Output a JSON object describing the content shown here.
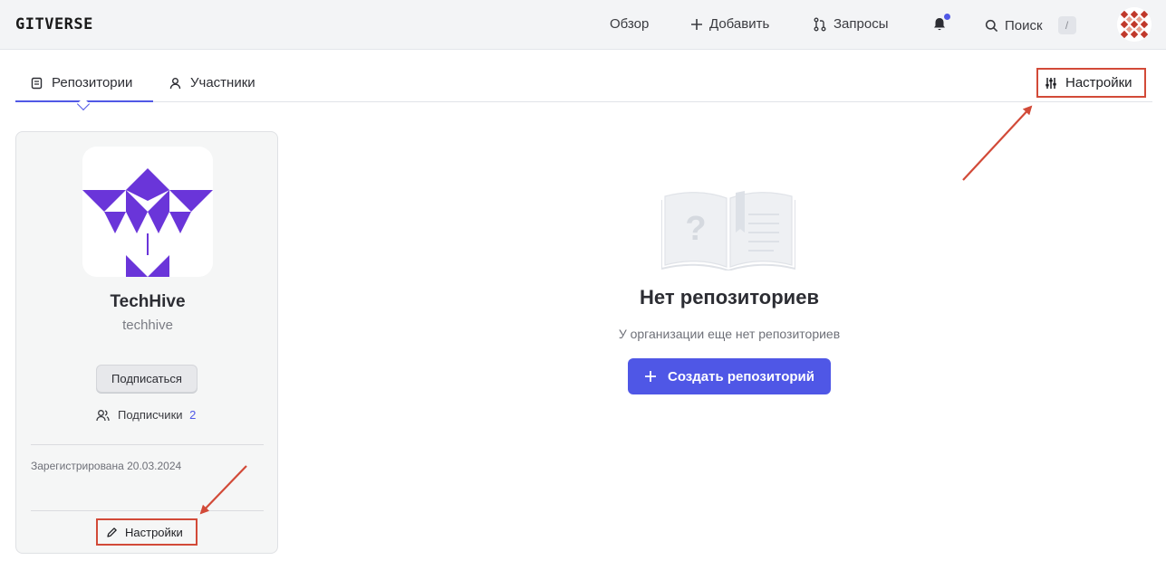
{
  "header": {
    "logo": "GITVERSE",
    "nav": {
      "overview": "Обзор",
      "add": "Добавить",
      "requests": "Запросы",
      "search": "Поиск",
      "search_shortcut": "/"
    },
    "notification_dot": true
  },
  "tabs": {
    "repositories": "Репозитории",
    "members": "Участники",
    "active": "repositories",
    "settings": "Настройки"
  },
  "org": {
    "name": "TechHive",
    "slug": "techhive",
    "subscribe_label": "Подписаться",
    "followers_label": "Подписчики",
    "followers_count": "2",
    "registered": "Зарегистрирована 20.03.2024",
    "settings_label": "Настройки"
  },
  "empty_state": {
    "title": "Нет репозиториев",
    "subtitle": "У организации еще нет репозиториев",
    "create_button": "Создать репозиторий"
  },
  "colors": {
    "accent": "#4f57e6",
    "logo_purple": "#6a35d9",
    "highlight": "#d24a38"
  }
}
